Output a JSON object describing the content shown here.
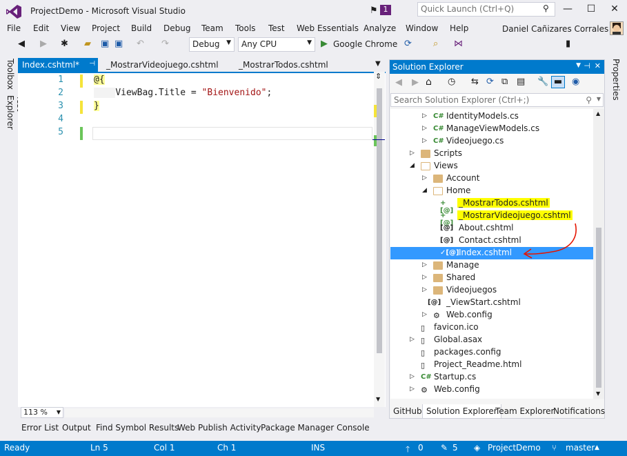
{
  "window": {
    "title": "ProjectDemo - Microsoft Visual Studio",
    "notification_count": "1",
    "quick_launch_placeholder": "Quick Launch (Ctrl+Q)",
    "minimize": "—",
    "maximize": "☐",
    "close": "✕"
  },
  "menu": [
    "File",
    "Edit",
    "View",
    "Project",
    "Build",
    "Debug",
    "Team",
    "Tools",
    "Test",
    "Web Essentials",
    "Analyze",
    "Window",
    "Help"
  ],
  "user": {
    "name": "Daniel Cañizares Corrales"
  },
  "toolbar": {
    "configuration": "Debug",
    "platform": "Any CPU",
    "run_target": "Google Chrome"
  },
  "rails": {
    "left": [
      "Toolbox",
      "Test Explorer"
    ],
    "right": [
      "Properties"
    ]
  },
  "editor": {
    "tabs": [
      "Index.cshtml*",
      "_MostrarVideojuego.cshtml",
      "_MostrarTodos.cshtml"
    ],
    "line_numbers": [
      "1",
      "2",
      "3",
      "4",
      "5"
    ],
    "lines": [
      "@{",
      "    ViewBag.Title = \"Bienvenido\";",
      "}",
      "",
      ""
    ],
    "code_parts": {
      "prop": "ViewBag.Title = ",
      "string": "\"Bienvenido\"",
      "end": ";"
    },
    "zoom": "113 %"
  },
  "solution_explorer": {
    "title": "Solution Explorer",
    "search_placeholder": "Search Solution Explorer (Ctrl+;)",
    "items": [
      {
        "label": "IdentityModels.cs",
        "type": "cs",
        "level": 3,
        "expander": true
      },
      {
        "label": "ManageViewModels.cs",
        "type": "cs",
        "level": 3,
        "expander": true
      },
      {
        "label": "Videojuego.cs",
        "type": "cs",
        "level": 3,
        "expander": true
      },
      {
        "label": "Scripts",
        "type": "folder",
        "level": 2,
        "expander": true
      },
      {
        "label": "Views",
        "type": "folder-open",
        "level": 2,
        "expander": "open"
      },
      {
        "label": "Account",
        "type": "folder",
        "level": 3,
        "expander": true
      },
      {
        "label": "Home",
        "type": "folder-open",
        "level": 3,
        "expander": "open"
      },
      {
        "label": "_MostrarTodos.cshtml",
        "type": "cshtml-new",
        "level": 4,
        "highlight": true
      },
      {
        "label": "_MostrarVideojuego.cshtml",
        "type": "cshtml-new",
        "level": 4,
        "highlight": true
      },
      {
        "label": "About.cshtml",
        "type": "cshtml",
        "level": 4
      },
      {
        "label": "Contact.cshtml",
        "type": "cshtml",
        "level": 4
      },
      {
        "label": "Index.cshtml",
        "type": "cshtml-edit",
        "level": 4,
        "selected": true
      },
      {
        "label": "Manage",
        "type": "folder",
        "level": 3,
        "expander": true
      },
      {
        "label": "Shared",
        "type": "folder",
        "level": 3,
        "expander": true
      },
      {
        "label": "Videojuegos",
        "type": "folder",
        "level": 3,
        "expander": true
      },
      {
        "label": "_ViewStart.cshtml",
        "type": "cshtml",
        "level": 3
      },
      {
        "label": "Web.config",
        "type": "config",
        "level": 3,
        "expander": true
      },
      {
        "label": "favicon.ico",
        "type": "file",
        "level": 2
      },
      {
        "label": "Global.asax",
        "type": "file",
        "level": 2,
        "expander": true
      },
      {
        "label": "packages.config",
        "type": "file",
        "level": 2
      },
      {
        "label": "Project_Readme.html",
        "type": "file",
        "level": 2
      },
      {
        "label": "Startup.cs",
        "type": "cs",
        "level": 2,
        "expander": true
      },
      {
        "label": "Web.config",
        "type": "config",
        "level": 2,
        "expander": true
      }
    ],
    "tabs": [
      "GitHub",
      "Solution Explorer",
      "Team Explorer",
      "Notifications"
    ]
  },
  "bottom_tabs": [
    "Error List",
    "Output",
    "Find Symbol Results",
    "Web Publish Activity",
    "Package Manager Console"
  ],
  "status": {
    "state": "Ready",
    "line": "Ln 5",
    "col": "Col 1",
    "ch": "Ch 1",
    "mode": "INS",
    "push_count": "0",
    "edits_count": "5",
    "repo": "ProjectDemo",
    "branch": "master"
  },
  "colors": {
    "accent": "#007acc",
    "highlight": "#ffff00",
    "selection": "#3399ff",
    "annotation": "#e51400"
  }
}
